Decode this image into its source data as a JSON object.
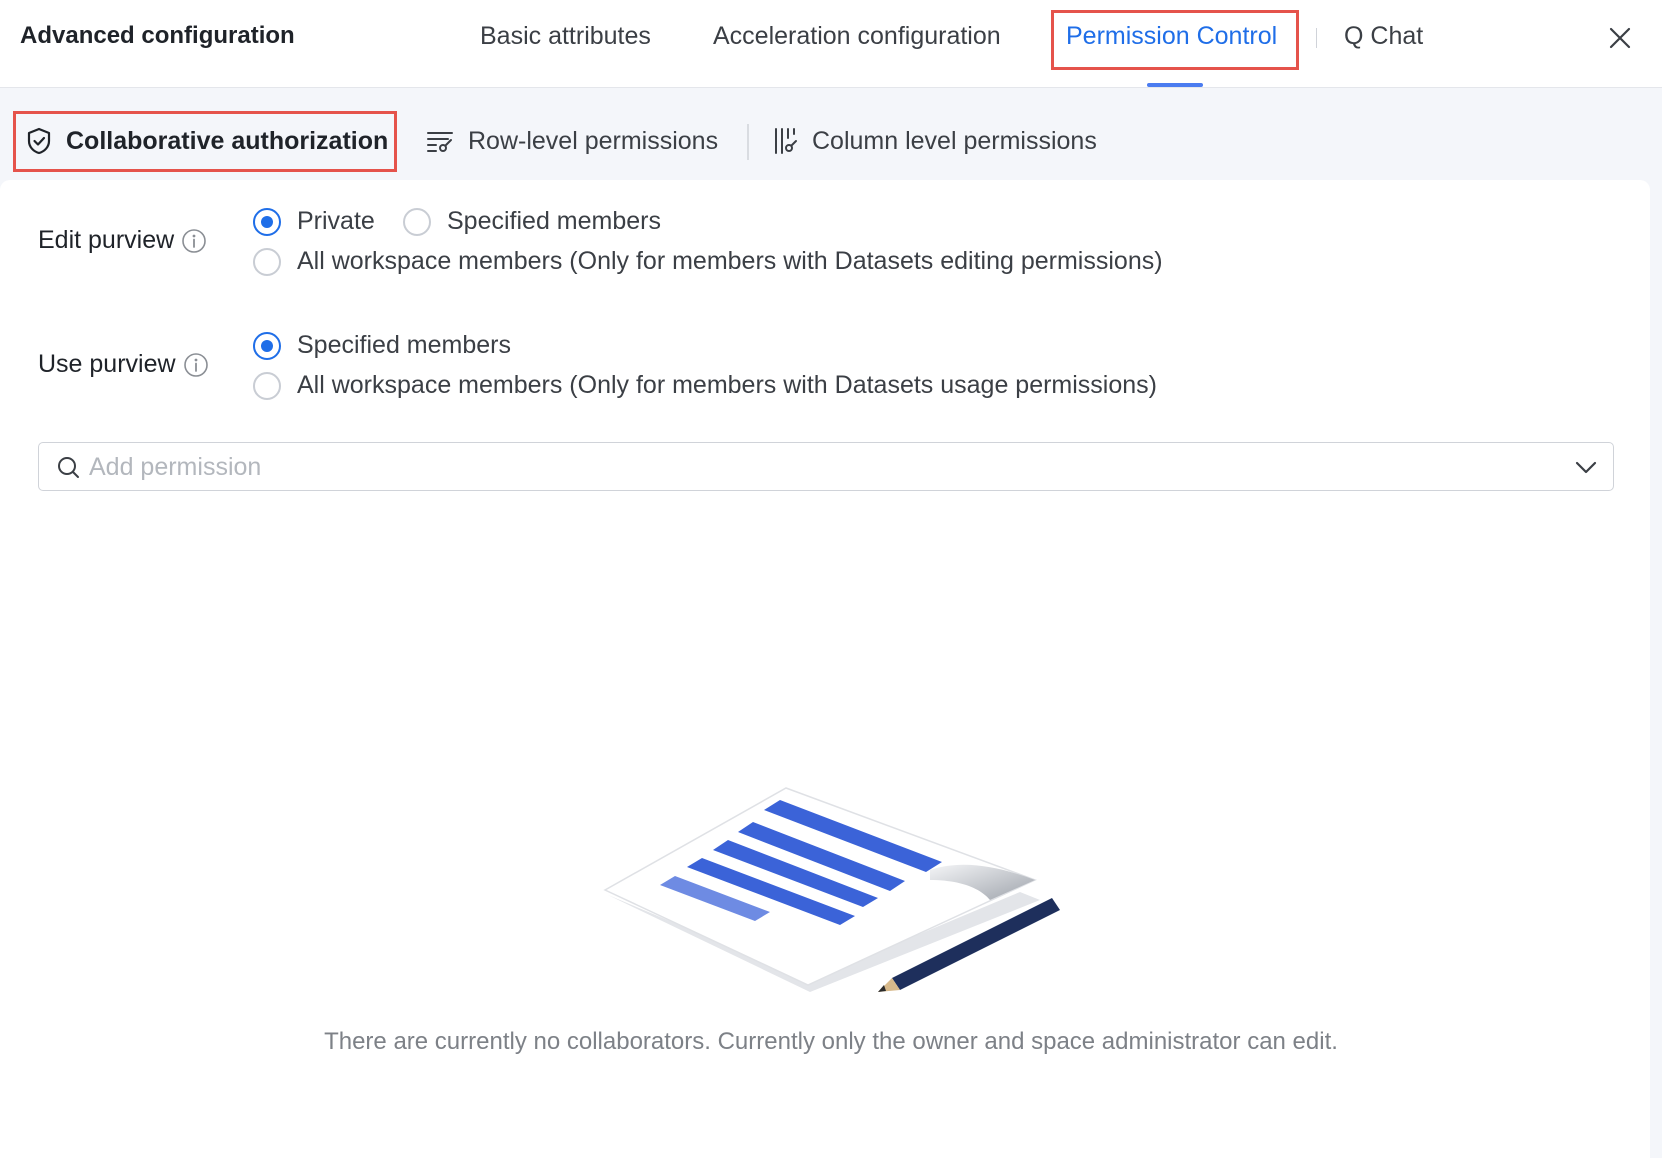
{
  "header": {
    "title": "Advanced configuration",
    "tabs": [
      {
        "label": "Basic attributes",
        "active": false
      },
      {
        "label": "Acceleration configuration",
        "active": false
      },
      {
        "label": "Permission Control",
        "active": true
      },
      {
        "label": "Q Chat",
        "active": false
      }
    ],
    "close_icon": "close-icon"
  },
  "subtabs": [
    {
      "label": "Collaborative authorization",
      "icon": "shield-check-icon",
      "active": true
    },
    {
      "label": "Row-level permissions",
      "icon": "row-filter-icon",
      "active": false
    },
    {
      "label": "Column level permissions",
      "icon": "column-filter-icon",
      "active": false
    }
  ],
  "edit_purview": {
    "label": "Edit purview",
    "info_icon": "info-icon",
    "options": [
      {
        "label": "Private",
        "checked": true
      },
      {
        "label": "Specified members",
        "checked": false
      },
      {
        "label": "All workspace members (Only for members with Datasets editing permissions)",
        "checked": false
      }
    ]
  },
  "use_purview": {
    "label": "Use purview",
    "info_icon": "info-icon",
    "options": [
      {
        "label": "Specified members",
        "checked": true
      },
      {
        "label": "All workspace members (Only for members with Datasets usage permissions)",
        "checked": false
      }
    ]
  },
  "search": {
    "placeholder": "Add permission",
    "value": "",
    "icon": "search-icon"
  },
  "empty_state": {
    "illustration": "document-pencil-illustration",
    "message": "There are currently no collaborators. Currently only the owner and space administrator can edit."
  },
  "colors": {
    "accent": "#1f6ee8",
    "highlight_box": "#e5534b",
    "illustration_blue": "#3b63d8",
    "pencil": "#1e2f5c"
  }
}
